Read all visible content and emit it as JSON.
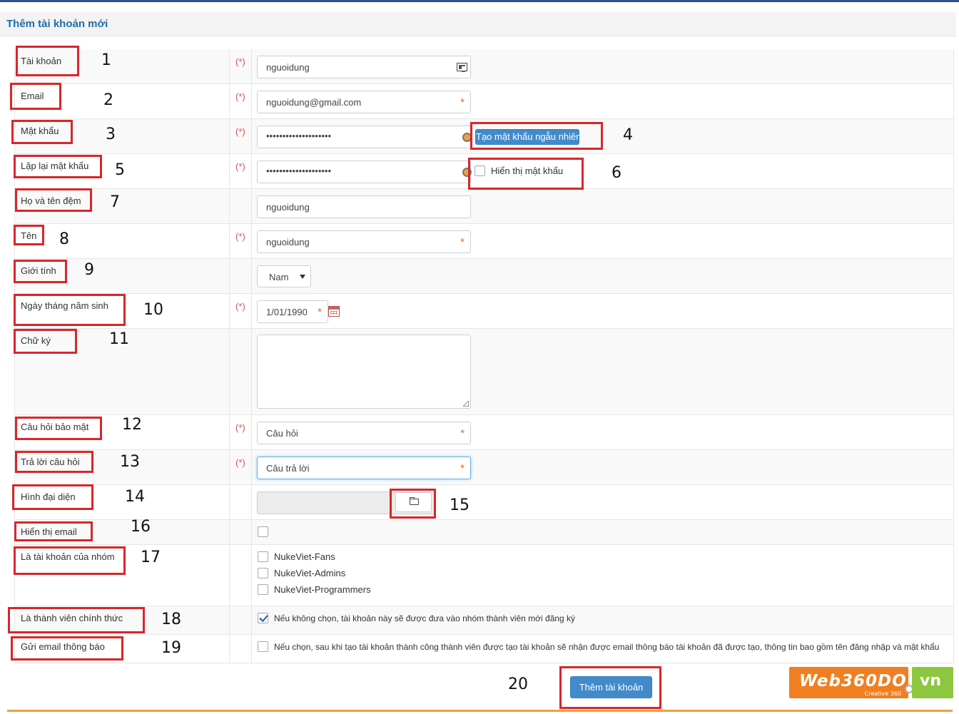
{
  "header": {
    "title": "Thêm tài khoản mới"
  },
  "required_marker": "(*)",
  "input_required_star": "*",
  "fields": {
    "username": {
      "label": "Tài khoản",
      "value": "nguoidung",
      "number": "1"
    },
    "email": {
      "label": "Email",
      "value": "nguoidung@gmail.com",
      "number": "2"
    },
    "password": {
      "label": "Mật khẩu",
      "value": "••••••••••••••••••••",
      "number": "3"
    },
    "generate_password": {
      "label": "Tạo mật khẩu ngẫu nhiên",
      "number": "4"
    },
    "password_repeat": {
      "label": "Lặp lại mật khẩu",
      "value": "••••••••••••••••••••",
      "number": "5"
    },
    "show_password": {
      "label": "Hiển thị mật khẩu",
      "number": "6",
      "checked": false
    },
    "last_name": {
      "label": "Họ và tên đệm",
      "value": "nguoidung",
      "number": "7"
    },
    "first_name": {
      "label": "Tên",
      "value": "nguoidung",
      "number": "8"
    },
    "gender": {
      "label": "Giới tính",
      "value": "Nam",
      "number": "9"
    },
    "birthday": {
      "label": "Ngày tháng năm sinh",
      "value": "1/01/1990",
      "number": "10"
    },
    "signature": {
      "label": "Chữ ký",
      "value": "",
      "number": "11"
    },
    "question": {
      "label": "Câu hỏi bảo mật",
      "value": "Câu hỏi",
      "number": "12"
    },
    "answer": {
      "label": "Trả lời câu hỏi",
      "value": "Câu trả lời",
      "number": "13"
    },
    "avatar": {
      "label": "Hình đại diện",
      "number": "14",
      "browse_number": "15"
    },
    "view_email": {
      "label": "Hiển thị email",
      "number": "16",
      "checked": false
    },
    "groups": {
      "label": "Là tài khoản của nhóm",
      "number": "17",
      "options": [
        "NukeViet-Fans",
        "NukeViet-Admins",
        "NukeViet-Programmers"
      ]
    },
    "official": {
      "label": "Là thành viên chính thức",
      "number": "18",
      "checked": true,
      "note": "Nếu không chọn, tài khoản này sẽ được đưa vào nhóm thành viên mới đăng ký"
    },
    "send_email": {
      "label": "Gửi email thông báo",
      "number": "19",
      "checked": false,
      "note": "Nếu chọn, sau khi tạo tài khoản thành công thành viên được tạo tài khoản sẽ nhận được email thông báo tài khoản đã được tạo, thông tin bao gồm tên đăng nhập và mật khẩu"
    }
  },
  "submit": {
    "label": "Thêm tài khoản",
    "number": "20"
  },
  "logo": {
    "brand": "Web360DO",
    "tld": "vn",
    "tagline": "Creative 360"
  },
  "colors": {
    "accent": "#428bca",
    "title": "#1f6ea8",
    "required": "#d9534f",
    "annotation_box": "#d8262b",
    "logo_orange": "#f07f22",
    "logo_green": "#8dc63f"
  }
}
